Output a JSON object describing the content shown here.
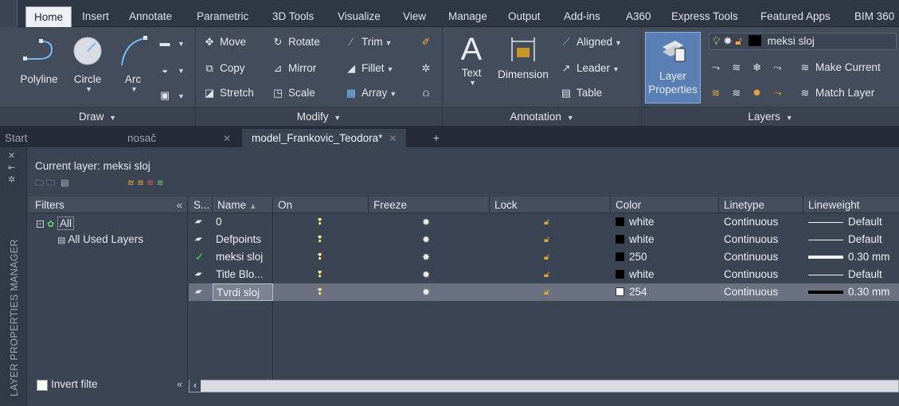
{
  "ribbon_tabs": [
    "Home",
    "Insert",
    "Annotate",
    "Parametric",
    "3D Tools",
    "Visualize",
    "View",
    "Manage",
    "Output",
    "Add-ins",
    "A360",
    "Express Tools",
    "Featured Apps",
    "BIM 360"
  ],
  "draw_panel": {
    "title": "Draw",
    "polyline": "Polyline",
    "circle": "Circle",
    "arc": "Arc"
  },
  "modify_panel": {
    "title": "Modify",
    "move": "Move",
    "rotate": "Rotate",
    "trim": "Trim",
    "copy": "Copy",
    "mirror": "Mirror",
    "fillet": "Fillet",
    "stretch": "Stretch",
    "scale": "Scale",
    "array": "Array"
  },
  "annotation_panel": {
    "title": "Annotation",
    "text": "Text",
    "dimension": "Dimension",
    "aligned": "Aligned",
    "leader": "Leader",
    "table": "Table"
  },
  "layers_panel": {
    "title": "Layers",
    "layer_properties_line1": "Layer",
    "layer_properties_line2": "Properties",
    "current_layer_name": "meksi sloj",
    "make_current": "Make Current",
    "match_layer": "Match Layer"
  },
  "doc_tabs": {
    "start": "Start",
    "tab1": "nosač",
    "tab2": "model_Frankovic_Teodora*",
    "new_tab": "+"
  },
  "palette": {
    "side_label": "LAYER PROPERTIES MANAGER",
    "current_layer": "Current layer: meksi sloj",
    "filters_header": "Filters",
    "tree_all": "All",
    "tree_used": "All Used Layers",
    "invert_filter": "Invert filte",
    "columns": [
      "S...",
      "Name",
      "On",
      "Freeze",
      "Lock",
      "Color",
      "Linetype",
      "Lineweight"
    ],
    "layers": [
      {
        "status": "layer",
        "name": "0",
        "color_name": "white",
        "color_hex": "#000000",
        "linetype": "Continuous",
        "lineweight": "Default",
        "lw_heavy": false
      },
      {
        "status": "layer",
        "name": "Defpoints",
        "color_name": "white",
        "color_hex": "#000000",
        "linetype": "Continuous",
        "lineweight": "Default",
        "lw_heavy": false
      },
      {
        "status": "current",
        "name": "meksi sloj",
        "color_name": "250",
        "color_hex": "#000000",
        "linetype": "Continuous",
        "lineweight": "0.30 mm",
        "lw_heavy": true
      },
      {
        "status": "layer",
        "name": "Title Blo...",
        "color_name": "white",
        "color_hex": "#000000",
        "linetype": "Continuous",
        "lineweight": "Default",
        "lw_heavy": false
      },
      {
        "status": "layer",
        "name": "Tvrdi sloj",
        "color_name": "254",
        "color_hex": "#ffffff",
        "linetype": "Continuous",
        "lineweight": "0.30 mm",
        "lw_heavy": true,
        "selected": true
      }
    ]
  },
  "colors": {
    "ribbon_bg": "#434c5b",
    "palette_bg": "#3b4453",
    "selected_row": "#6b7180",
    "bulb_yellow": "#f3e27a",
    "current_check": "#4caf50"
  }
}
